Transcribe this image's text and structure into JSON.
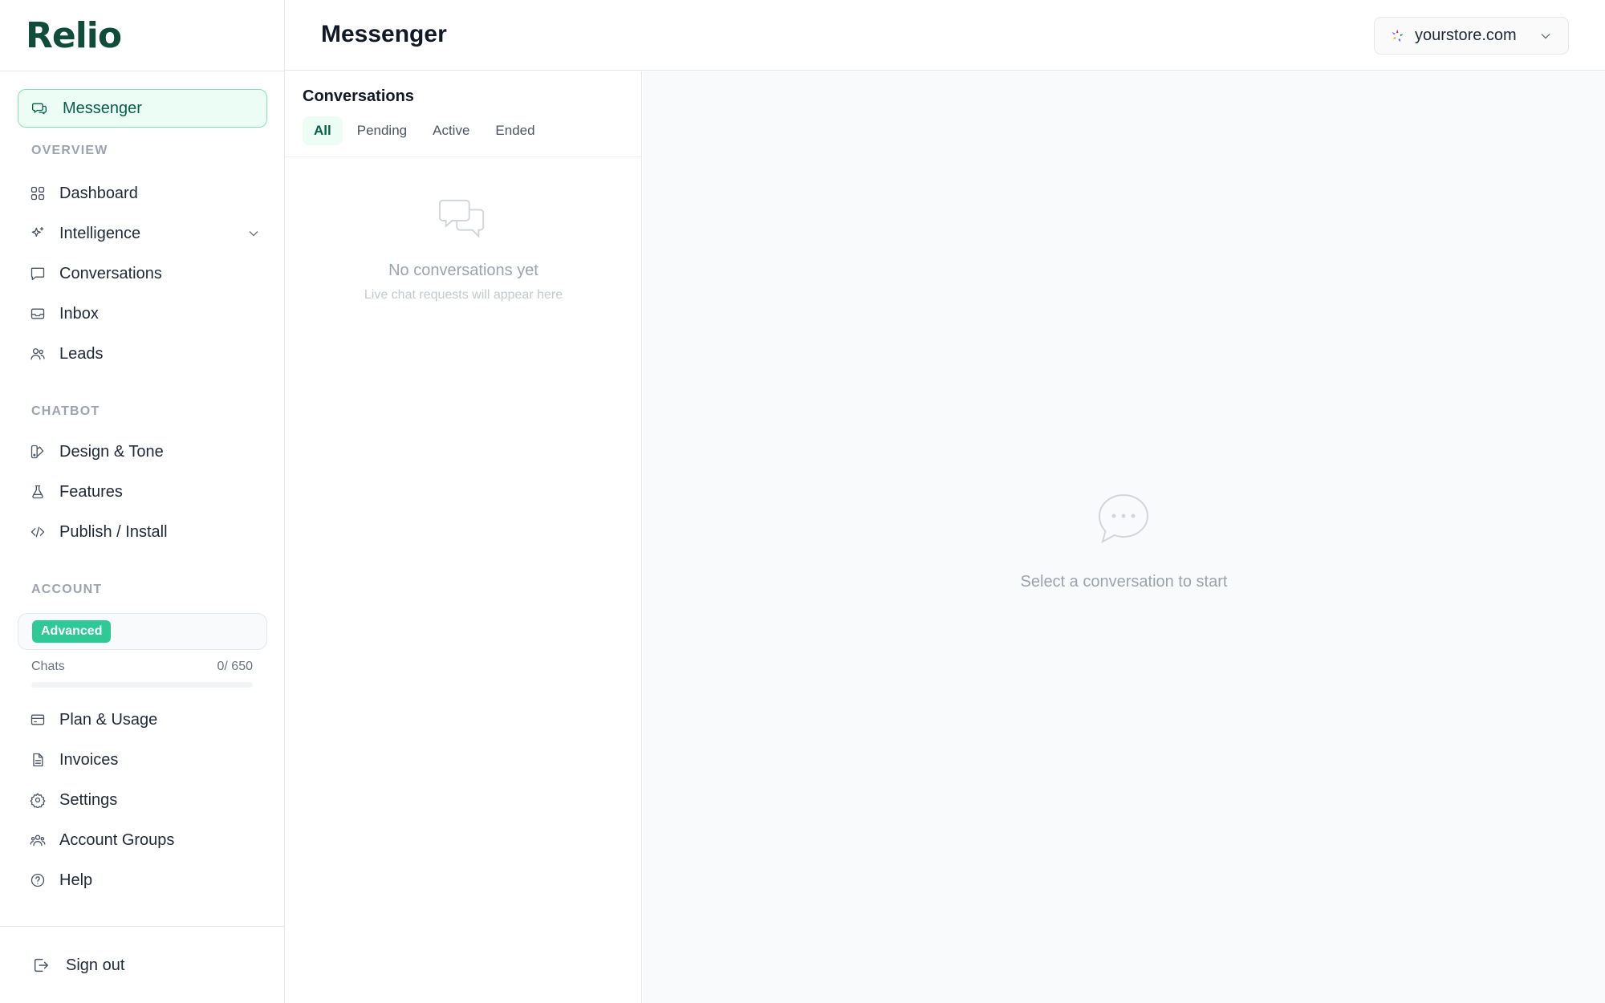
{
  "brand": {
    "logo_text": "Relio"
  },
  "header": {
    "title": "Messenger",
    "store": "yourstore.com"
  },
  "sidebar": {
    "active_item": "Messenger",
    "sections": {
      "overview": "OVERVIEW",
      "chatbot": "CHATBOT",
      "account": "ACCOUNT"
    },
    "overview_items": [
      "Dashboard",
      "Intelligence",
      "Conversations",
      "Inbox",
      "Leads"
    ],
    "chatbot_items": [
      "Design & Tone",
      "Features",
      "Publish / Install"
    ],
    "plan": {
      "badge": "Advanced",
      "usage_label": "Chats",
      "usage_value": "0/ 650",
      "usage_used": 0,
      "usage_limit": 650
    },
    "account_items": [
      "Plan & Usage",
      "Invoices",
      "Settings",
      "Account Groups",
      "Help"
    ],
    "sign_out": "Sign out"
  },
  "conversations": {
    "title": "Conversations",
    "tabs": [
      "All",
      "Pending",
      "Active",
      "Ended"
    ],
    "active_tab": "All",
    "empty_title": "No conversations yet",
    "empty_subtitle": "Live chat requests will appear here"
  },
  "detail": {
    "empty_text": "Select a conversation to start"
  },
  "colors": {
    "accent": "#2ec995",
    "accent_dark": "#065f46",
    "brand": "#0f4c3a"
  }
}
